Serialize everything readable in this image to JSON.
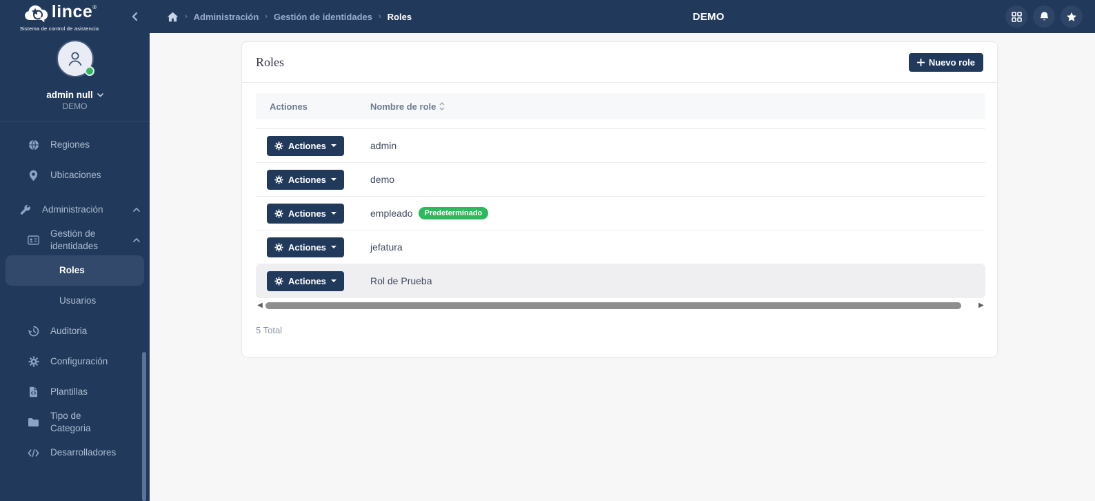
{
  "brand": {
    "name": "lince",
    "registered": "®",
    "tagline": "Sistema de control de asistencia"
  },
  "navbar": {
    "breadcrumb": [
      {
        "label": "Administración"
      },
      {
        "label": "Gestión de identidades"
      },
      {
        "label": "Roles"
      }
    ],
    "separator": "›",
    "title": "DEMO"
  },
  "user": {
    "name": "admin null",
    "org": "DEMO",
    "status": "online"
  },
  "sidebar": {
    "items": [
      {
        "label": "Regiones"
      },
      {
        "label": "Ubicaciones"
      },
      {
        "label": "Administración"
      },
      {
        "label": "Gestión de identidades"
      },
      {
        "label": "Roles"
      },
      {
        "label": "Usuarios"
      },
      {
        "label": "Auditoria"
      },
      {
        "label": "Configuración"
      },
      {
        "label": "Plantillas"
      },
      {
        "label": "Tipo de Categoria"
      },
      {
        "label": "Desarrolladores"
      }
    ]
  },
  "main": {
    "card_title": "Roles",
    "new_button_label": "Nuevo role",
    "table": {
      "headers": {
        "actions": "Actiones",
        "name": "Nombre de role"
      },
      "action_button_label": "Actiones",
      "rows": [
        {
          "name": "admin"
        },
        {
          "name": "demo"
        },
        {
          "name": "empleado",
          "badge": "Predeterminado"
        },
        {
          "name": "jefatura"
        },
        {
          "name": "Rol de Prueba"
        }
      ]
    },
    "total": "5 Total",
    "scrollbar": {
      "left_arrow": "◀",
      "right_arrow": "▶"
    }
  },
  "colors": {
    "navy": "#213A5C",
    "active_item": "#32496C",
    "green": "#2EB85C",
    "page_bg": "#F7F7F8",
    "header_text": "#6E7B8E",
    "row_text": "#3F4A5F"
  }
}
